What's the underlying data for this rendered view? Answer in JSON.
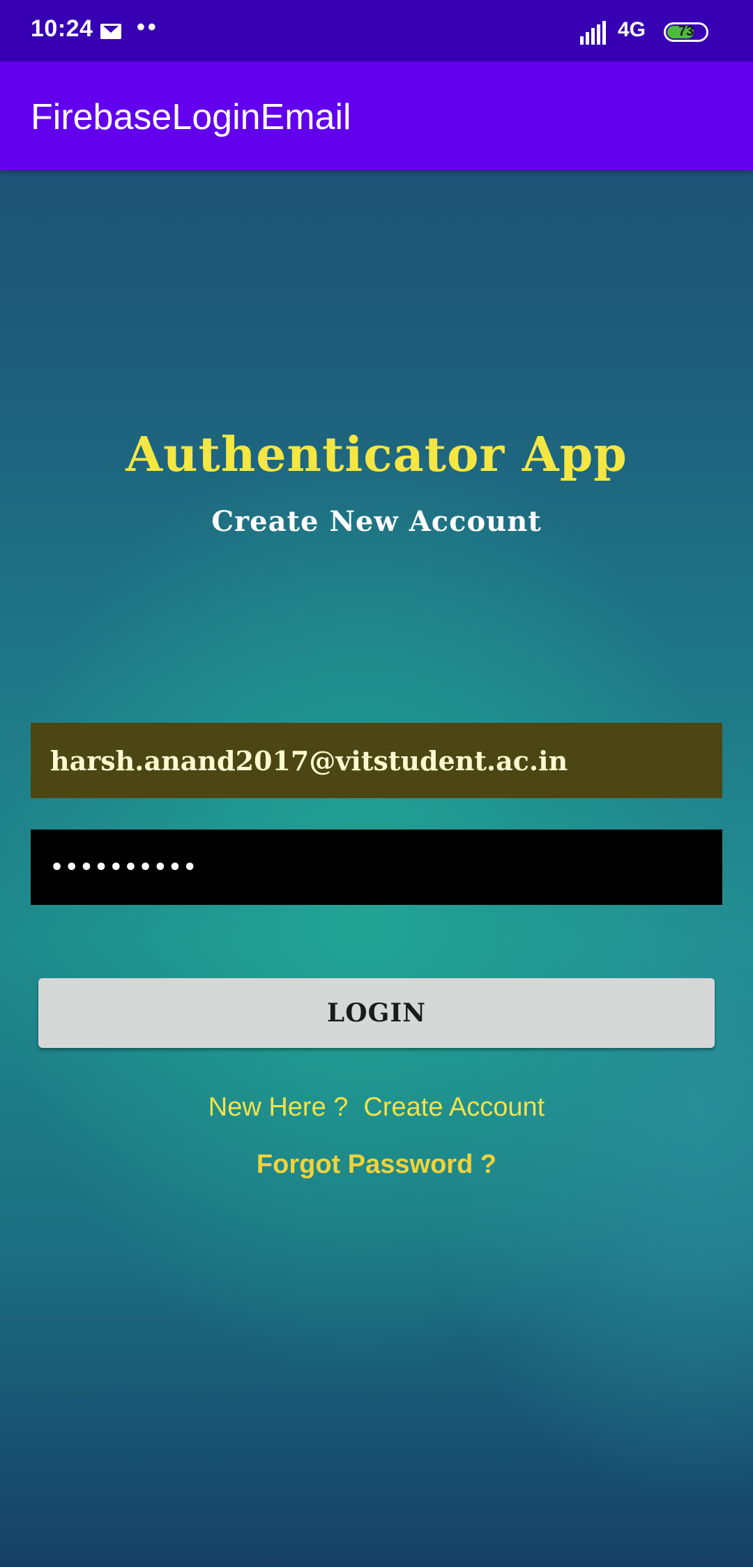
{
  "status_bar": {
    "time": "10:24",
    "notification_dots": "••",
    "network": "4G",
    "battery_level": "73",
    "battery_fraction": 0.73
  },
  "app_bar": {
    "title": "FirebaseLoginEmail"
  },
  "header": {
    "title": "Authenticator App",
    "subtitle": "Create New Account"
  },
  "form": {
    "email_value": "harsh.anand2017@vitstudent.ac.in",
    "password_masked": "••••••••••",
    "login_label": "LOGIN"
  },
  "links": {
    "new_here": "New Here ?",
    "create_account": "Create Account",
    "forgot_password": "Forgot Password ?"
  },
  "colors": {
    "status_bar": "#3700b3",
    "app_bar": "#6200ee",
    "title_yellow": "#f5e642",
    "email_field_bg": "#4c4614",
    "password_field_bg": "#000000",
    "button_bg": "#d6d7d7"
  }
}
